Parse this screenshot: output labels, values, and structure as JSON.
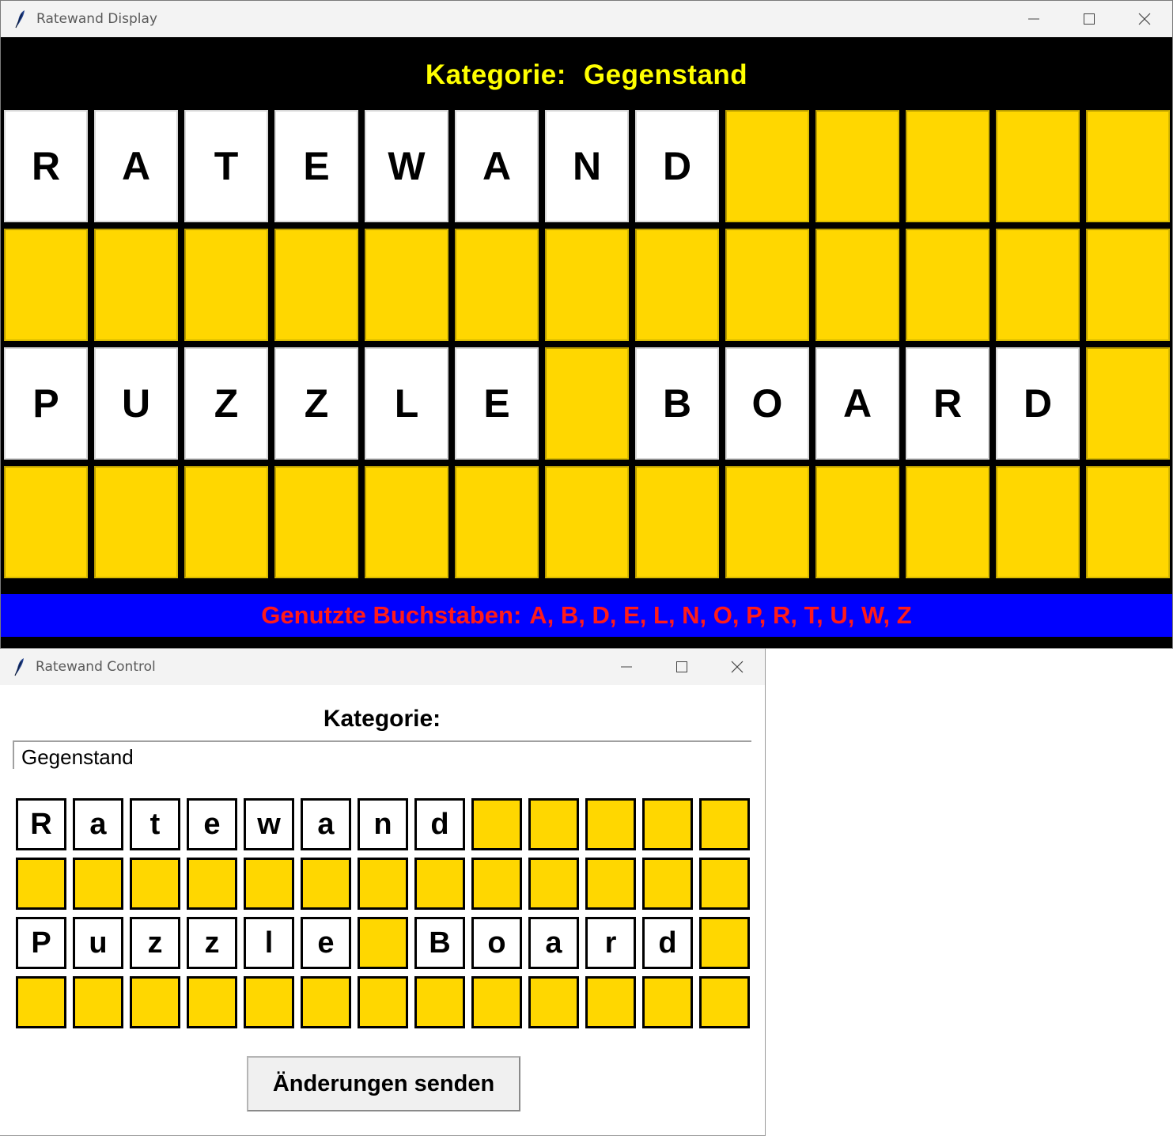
{
  "display": {
    "window_title": "Ratewand Display",
    "category_label": "Kategorie:",
    "category_value": "Gegenstand",
    "used_letters_label": "Genutzte Buchstaben:",
    "used_letters": "A, B, D, E, L, N, O, P, R, T, U, W, Z",
    "grid_rows": [
      [
        "R",
        "A",
        "T",
        "E",
        "W",
        "A",
        "N",
        "D",
        "",
        "",
        "",
        "",
        ""
      ],
      [
        "",
        "",
        "",
        "",
        "",
        "",
        "",
        "",
        "",
        "",
        "",
        "",
        ""
      ],
      [
        "P",
        "U",
        "Z",
        "Z",
        "L",
        "E",
        "",
        "B",
        "O",
        "A",
        "R",
        "D",
        ""
      ],
      [
        "",
        "",
        "",
        "",
        "",
        "",
        "",
        "",
        "",
        "",
        "",
        "",
        ""
      ]
    ]
  },
  "control": {
    "window_title": "Ratewand Control",
    "category_label": "Kategorie:",
    "category_input_value": "Gegenstand",
    "grid_rows": [
      [
        "R",
        "a",
        "t",
        "e",
        "w",
        "a",
        "n",
        "d",
        "",
        "",
        "",
        "",
        ""
      ],
      [
        "",
        "",
        "",
        "",
        "",
        "",
        "",
        "",
        "",
        "",
        "",
        "",
        ""
      ],
      [
        "P",
        "u",
        "z",
        "z",
        "l",
        "e",
        "",
        "B",
        "o",
        "a",
        "r",
        "d",
        ""
      ],
      [
        "",
        "",
        "",
        "",
        "",
        "",
        "",
        "",
        "",
        "",
        "",
        "",
        ""
      ]
    ],
    "send_button_label": "Änderungen senden"
  },
  "colors": {
    "empty_cell": "#ffd700",
    "category_text": "#ffff00",
    "used_bar_bg": "#0000ff",
    "used_bar_text": "#ff1a1a"
  },
  "icons": {
    "app": "feather-icon",
    "minimize": "minimize-icon",
    "maximize": "maximize-icon",
    "close": "close-icon"
  }
}
